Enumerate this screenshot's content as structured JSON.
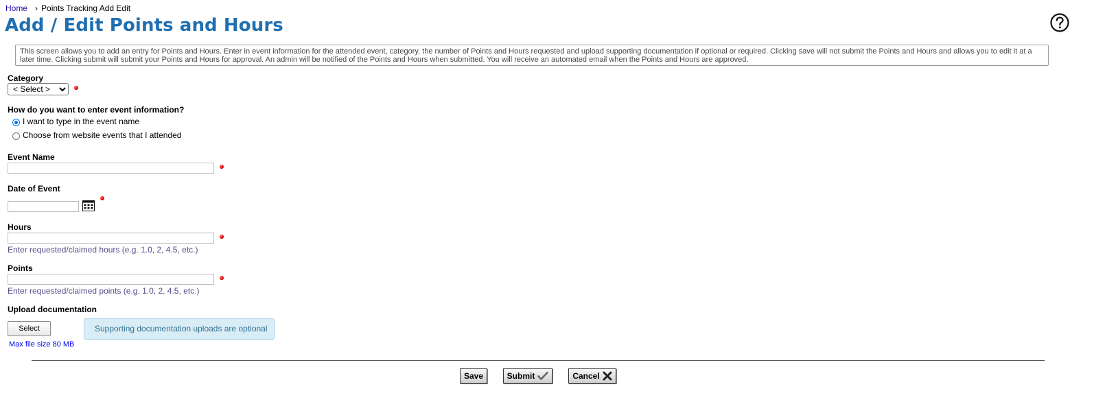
{
  "breadcrumb": {
    "home": "Home",
    "separator": "›",
    "current": "Points Tracking Add Edit"
  },
  "page_title": "Add / Edit Points and Hours",
  "intro_text": "This screen allows you to add an entry for Points and Hours. Enter in event information for the attended event, category, the number of Points and Hours requested and upload supporting documentation if optional or required. Clicking save will not submit the Points and Hours and allows you to edit it at a later time. Clicking submit will submit your Points and Hours for approval. An admin will be notified of the Points and Hours when submitted. You will receive an automated email when the Points and Hours are approved.",
  "category": {
    "label": "Category",
    "selected": "< Select >"
  },
  "event_entry": {
    "question": "How do you want to enter event information?",
    "options": [
      "I want to type in the event name",
      "Choose from website events that I attended"
    ],
    "selected_index": 0
  },
  "event_name": {
    "label": "Event Name",
    "value": ""
  },
  "date_of_event": {
    "label": "Date of Event",
    "value": ""
  },
  "hours": {
    "label": "Hours",
    "value": "",
    "hint": "Enter requested/claimed hours (e.g. 1.0, 2, 4.5, etc.)"
  },
  "points": {
    "label": "Points",
    "value": "",
    "hint": "Enter requested/claimed points (e.g. 1.0, 2, 4.5, etc.)"
  },
  "upload": {
    "label": "Upload documentation",
    "select_label": "Select",
    "notice": "Supporting documentation uploads are optional",
    "max_size": "Max file size 80 MB"
  },
  "actions": {
    "save": "Save",
    "submit": "Submit",
    "cancel": "Cancel"
  },
  "icons": {
    "help": "help-circle-icon",
    "required": "required-dot-icon",
    "calendar": "calendar-icon",
    "submit": "checkmark-icon",
    "cancel": "close-icon"
  },
  "colors": {
    "title": "#1f6fb2",
    "link": "#1a0dab",
    "required": "#e60000",
    "hint": "#5b4b8a",
    "notice_bg": "#d9edf7"
  }
}
